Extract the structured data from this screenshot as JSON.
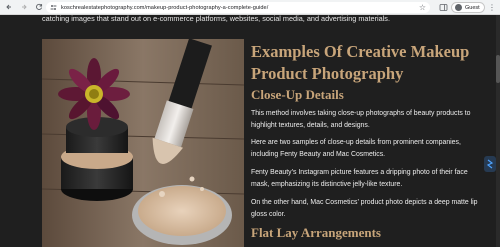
{
  "browser": {
    "url": "koschrealestatephotography.com/makeup-product-photography-a-complete-guide/",
    "profile_label": "Guest"
  },
  "article": {
    "intro_fragment": "catching images that stand out on e-commerce platforms, websites, social media, and advertising materials.",
    "main_heading": "Examples Of Creative Makeup Product Photography",
    "section_heading": "Close-Up Details",
    "paragraphs": [
      "This method involves taking close-up photographs of beauty products to highlight textures, details, and designs.",
      "Here are two samples of close-up details from prominent companies, including Fenty Beauty and Mac Cosmetics.",
      "Fenty Beauty’s Instagram picture features a dripping photo of their face mask, emphasizing its distinctive jelly-like texture.",
      "On the other hand, Mac Cosmetics’ product photo depicts a deep matte lip gloss color."
    ],
    "next_heading": "Flat Lay Arrangements"
  },
  "colors": {
    "page_background": "#1f1f1f",
    "heading_gold": "#c8a57a",
    "body_text": "#ededed"
  }
}
